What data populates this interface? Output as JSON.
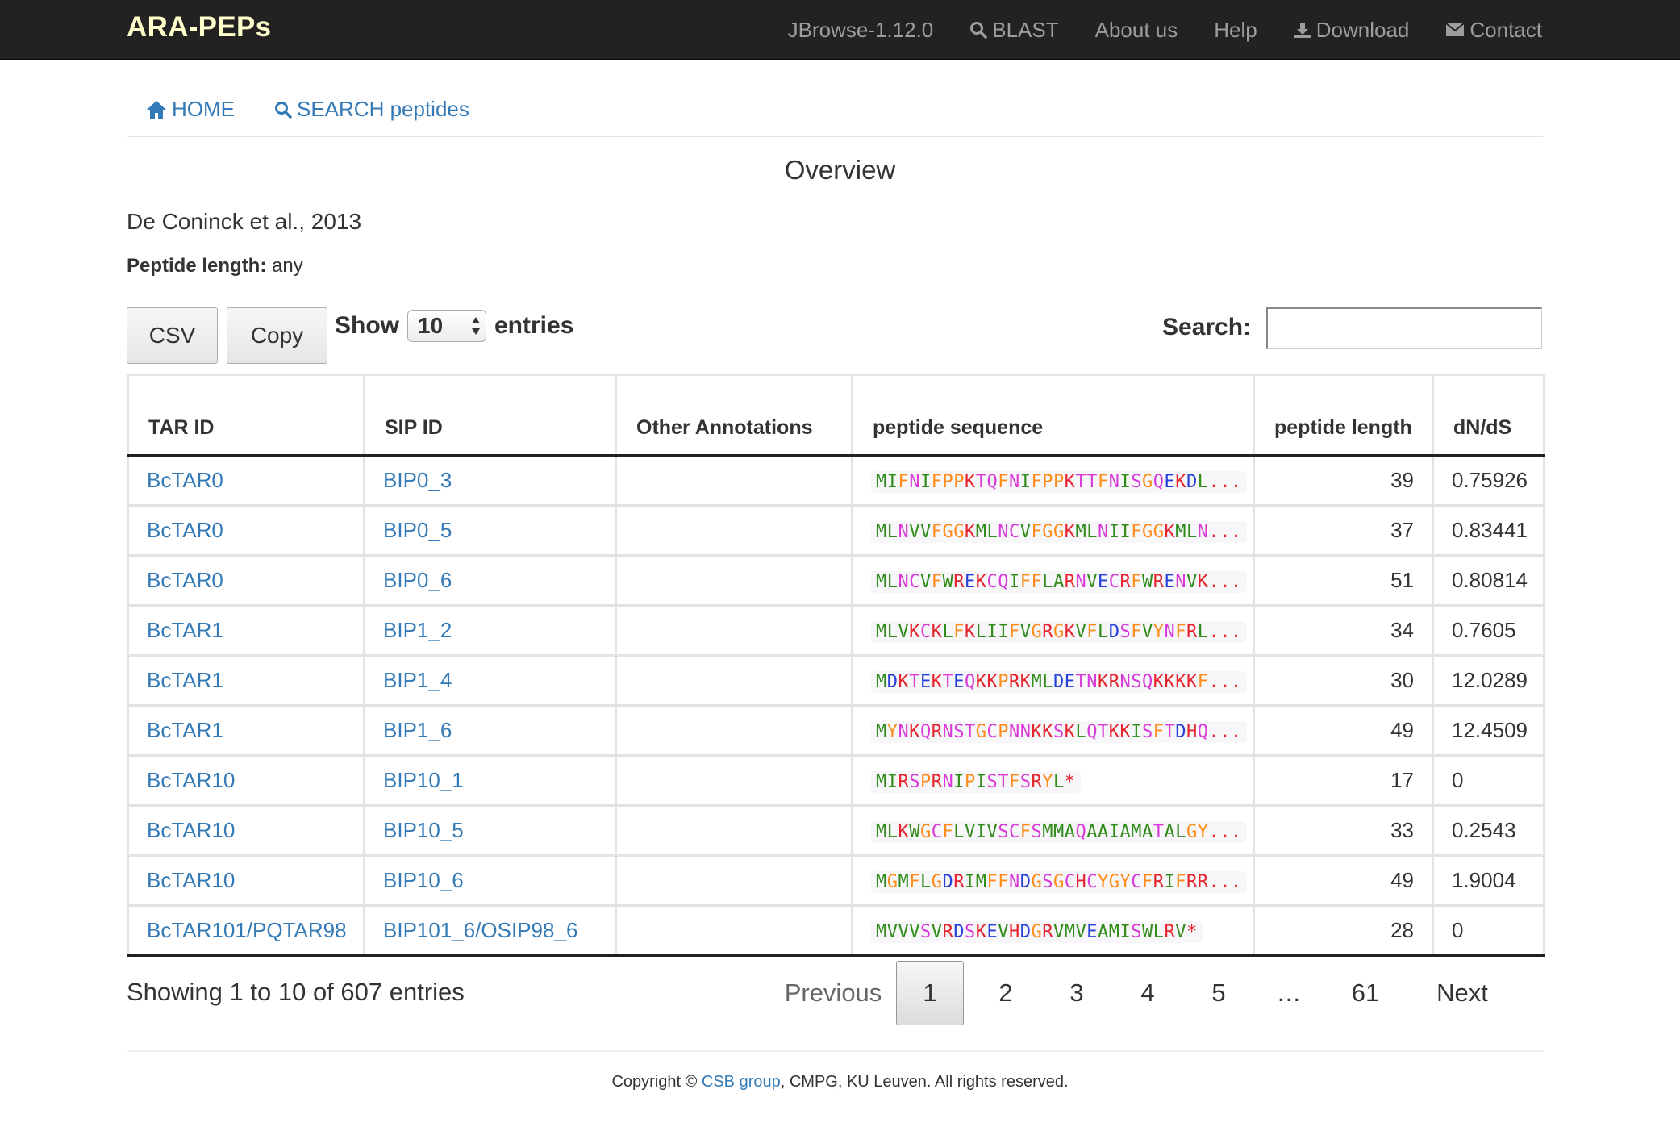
{
  "navbar": {
    "brand": "ARA-PEPs",
    "links": [
      {
        "label": "JBrowse-1.12.0",
        "icon": ""
      },
      {
        "label": "BLAST",
        "icon": "search-icon"
      },
      {
        "label": "About us",
        "icon": ""
      },
      {
        "label": "Help",
        "icon": ""
      },
      {
        "label": "Download",
        "icon": "download-icon"
      },
      {
        "label": "Contact",
        "icon": "envelope-icon"
      }
    ]
  },
  "subnav": {
    "home": "HOME",
    "search": "SEARCH peptides"
  },
  "page": {
    "title": "Overview",
    "source": "De Coninck et al., 2013",
    "peptide_length_label": "Peptide length:",
    "peptide_length_value": "any"
  },
  "controls": {
    "csv": "CSV",
    "copy": "Copy",
    "show_label": "Show",
    "show_value": "10",
    "entries_label": "entries",
    "search_label": "Search:",
    "search_value": ""
  },
  "table": {
    "headers": [
      "TAR ID",
      "SIP ID",
      "Other Annotations",
      "peptide sequence",
      "peptide length",
      "dN/dS"
    ],
    "rows": [
      {
        "tar": "BcTAR0",
        "sip": "BIP0_3",
        "other": "",
        "seq": "MIFNIFPPKTQFNIFPPKTTFNISGQEKDL...",
        "len": "39",
        "dnds": "0.75926"
      },
      {
        "tar": "BcTAR0",
        "sip": "BIP0_5",
        "other": "",
        "seq": "MLNVVFGGKMLNCVFGGKMLNIIFGGKMLN...",
        "len": "37",
        "dnds": "0.83441"
      },
      {
        "tar": "BcTAR0",
        "sip": "BIP0_6",
        "other": "",
        "seq": "MLNCVFWREKCQIFFLARNVECRFWRENVK...",
        "len": "51",
        "dnds": "0.80814"
      },
      {
        "tar": "BcTAR1",
        "sip": "BIP1_2",
        "other": "",
        "seq": "MLVKCKLFKLIIFVGRGKVFLDSFVYNFRL...",
        "len": "34",
        "dnds": "0.7605"
      },
      {
        "tar": "BcTAR1",
        "sip": "BIP1_4",
        "other": "",
        "seq": "MDKTEKTEQKKPRKMLDETNKRNSQKKKKF...",
        "len": "30",
        "dnds": "12.0289"
      },
      {
        "tar": "BcTAR1",
        "sip": "BIP1_6",
        "other": "",
        "seq": "MYNKQRNSTGCPNNKKSKLQTKKISFTDHQ...",
        "len": "49",
        "dnds": "12.4509"
      },
      {
        "tar": "BcTAR10",
        "sip": "BIP10_1",
        "other": "",
        "seq": "MIRSPRNIPISTFSRYL*",
        "len": "17",
        "dnds": "0"
      },
      {
        "tar": "BcTAR10",
        "sip": "BIP10_5",
        "other": "",
        "seq": "MLKWGCFLVIVSCFSMMAQAAIAMATALGY...",
        "len": "33",
        "dnds": "0.2543"
      },
      {
        "tar": "BcTAR10",
        "sip": "BIP10_6",
        "other": "",
        "seq": "MGMFLGDRIMFFNDGSGCHCYGYCFRIFRR...",
        "len": "49",
        "dnds": "1.9004"
      },
      {
        "tar": "BcTAR101/PQTAR98",
        "sip": "BIP101_6/OSIP98_6",
        "other": "",
        "seq": "MVVVSVRDSKEVHDGRVMVEAMISWLRV*",
        "len": "28",
        "dnds": "0"
      }
    ]
  },
  "pagination": {
    "info": "Showing 1 to 10 of 607 entries",
    "previous": "Previous",
    "pages": [
      "1",
      "2",
      "3",
      "4",
      "5"
    ],
    "ellipsis": "…",
    "last": "61",
    "next": "Next"
  },
  "footer": {
    "prefix": "Copyright © ",
    "link": "CSB group",
    "suffix": ", CMPG, KU Leuven. All rights reserved."
  },
  "residue_colors": {
    "M": "#2e8b17",
    "I": "#2e8b17",
    "L": "#2e8b17",
    "V": "#2e8b17",
    "A": "#2e8b17",
    "W": "#2e8b17",
    "F": "#ff8c1a",
    "P": "#ff8c1a",
    "Y": "#ff8c1a",
    "N": "#d83bd8",
    "Q": "#d83bd8",
    "S": "#d83bd8",
    "T": "#d83bd8",
    "C": "#d83bd8",
    "G": "#ff8c1a",
    "K": "#e5242d",
    "R": "#e5242d",
    "H": "#e5242d",
    "D": "#2540d8",
    "E": "#2540d8",
    ".": "#e5242d",
    "*": "#e5242d"
  }
}
